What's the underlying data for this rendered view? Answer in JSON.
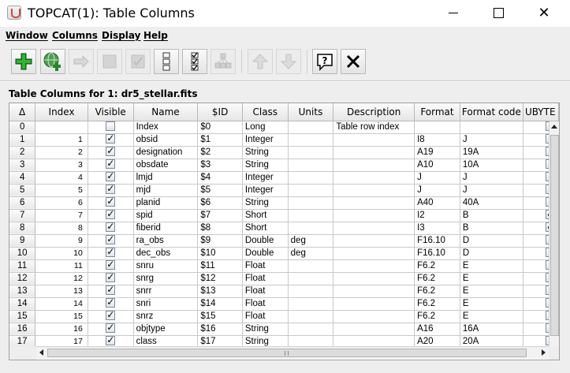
{
  "window": {
    "title": "TOPCAT(1): Table Columns",
    "minimize_glyph": "",
    "maximize_glyph": "",
    "close_glyph": "✕"
  },
  "menubar": [
    "Window",
    "Columns",
    "Display",
    "Help"
  ],
  "toolbar": {
    "buttons": [
      {
        "icon": "add-column-icon",
        "enabled": true
      },
      {
        "icon": "add-sky-column-icon",
        "enabled": true
      },
      {
        "icon": "replace-column-icon",
        "enabled": false
      },
      {
        "icon": "hide-column-icon",
        "enabled": false
      },
      {
        "icon": "show-column-icon",
        "enabled": false
      },
      {
        "icon": "hide-all-columns-icon",
        "enabled": true
      },
      {
        "icon": "show-all-columns-icon",
        "enabled": true
      },
      {
        "icon": "explode-column-icon",
        "enabled": false
      },
      {
        "icon": "move-up-icon",
        "enabled": false
      },
      {
        "icon": "move-down-icon",
        "enabled": false
      },
      {
        "icon": "help-icon",
        "enabled": true
      },
      {
        "icon": "close-icon",
        "enabled": true
      }
    ]
  },
  "panel": {
    "title": "Table Columns for 1: dr5_stellar.fits"
  },
  "table": {
    "corner_label": "Δ",
    "headers": [
      "Index",
      "Visible",
      "Name",
      "$ID",
      "Class",
      "Units",
      "Description",
      "Format",
      "Format code",
      "UBYTE"
    ],
    "rows": [
      {
        "row": "0",
        "index": "",
        "visible": false,
        "name": "Index",
        "id": "$0",
        "class": "Long",
        "units": "",
        "description": "Table row index",
        "format": "",
        "format_code": "",
        "ubyte": false
      },
      {
        "row": "1",
        "index": "1",
        "visible": true,
        "name": "obsid",
        "id": "$1",
        "class": "Integer",
        "units": "",
        "description": "",
        "format": "I8",
        "format_code": "J",
        "ubyte": false
      },
      {
        "row": "2",
        "index": "2",
        "visible": true,
        "name": "designation",
        "id": "$2",
        "class": "String",
        "units": "",
        "description": "",
        "format": "A19",
        "format_code": "19A",
        "ubyte": false
      },
      {
        "row": "3",
        "index": "3",
        "visible": true,
        "name": "obsdate",
        "id": "$3",
        "class": "String",
        "units": "",
        "description": "",
        "format": "A10",
        "format_code": "10A",
        "ubyte": false
      },
      {
        "row": "4",
        "index": "4",
        "visible": true,
        "name": "lmjd",
        "id": "$4",
        "class": "Integer",
        "units": "",
        "description": "",
        "format": "J",
        "format_code": "J",
        "ubyte": false
      },
      {
        "row": "5",
        "index": "5",
        "visible": true,
        "name": "mjd",
        "id": "$5",
        "class": "Integer",
        "units": "",
        "description": "",
        "format": "J",
        "format_code": "J",
        "ubyte": false
      },
      {
        "row": "6",
        "index": "6",
        "visible": true,
        "name": "planid",
        "id": "$6",
        "class": "String",
        "units": "",
        "description": "",
        "format": "A40",
        "format_code": "40A",
        "ubyte": false
      },
      {
        "row": "7",
        "index": "7",
        "visible": true,
        "name": "spid",
        "id": "$7",
        "class": "Short",
        "units": "",
        "description": "",
        "format": "I2",
        "format_code": "B",
        "ubyte": true
      },
      {
        "row": "8",
        "index": "8",
        "visible": true,
        "name": "fiberid",
        "id": "$8",
        "class": "Short",
        "units": "",
        "description": "",
        "format": "I3",
        "format_code": "B",
        "ubyte": true
      },
      {
        "row": "9",
        "index": "9",
        "visible": true,
        "name": "ra_obs",
        "id": "$9",
        "class": "Double",
        "units": "deg",
        "description": "",
        "format": "F16.10",
        "format_code": "D",
        "ubyte": false
      },
      {
        "row": "10",
        "index": "10",
        "visible": true,
        "name": "dec_obs",
        "id": "$10",
        "class": "Double",
        "units": "deg",
        "description": "",
        "format": "F16.10",
        "format_code": "D",
        "ubyte": false
      },
      {
        "row": "11",
        "index": "11",
        "visible": true,
        "name": "snru",
        "id": "$11",
        "class": "Float",
        "units": "",
        "description": "",
        "format": "F6.2",
        "format_code": "E",
        "ubyte": false
      },
      {
        "row": "12",
        "index": "12",
        "visible": true,
        "name": "snrg",
        "id": "$12",
        "class": "Float",
        "units": "",
        "description": "",
        "format": "F6.2",
        "format_code": "E",
        "ubyte": false
      },
      {
        "row": "13",
        "index": "13",
        "visible": true,
        "name": "snrr",
        "id": "$13",
        "class": "Float",
        "units": "",
        "description": "",
        "format": "F6.2",
        "format_code": "E",
        "ubyte": false
      },
      {
        "row": "14",
        "index": "14",
        "visible": true,
        "name": "snri",
        "id": "$14",
        "class": "Float",
        "units": "",
        "description": "",
        "format": "F6.2",
        "format_code": "E",
        "ubyte": false
      },
      {
        "row": "15",
        "index": "15",
        "visible": true,
        "name": "snrz",
        "id": "$15",
        "class": "Float",
        "units": "",
        "description": "",
        "format": "F6.2",
        "format_code": "E",
        "ubyte": false
      },
      {
        "row": "16",
        "index": "16",
        "visible": true,
        "name": "objtype",
        "id": "$16",
        "class": "String",
        "units": "",
        "description": "",
        "format": "A16",
        "format_code": "16A",
        "ubyte": false
      },
      {
        "row": "17",
        "index": "17",
        "visible": true,
        "name": "class",
        "id": "$17",
        "class": "String",
        "units": "",
        "description": "",
        "format": "A20",
        "format_code": "20A",
        "ubyte": false
      }
    ]
  }
}
